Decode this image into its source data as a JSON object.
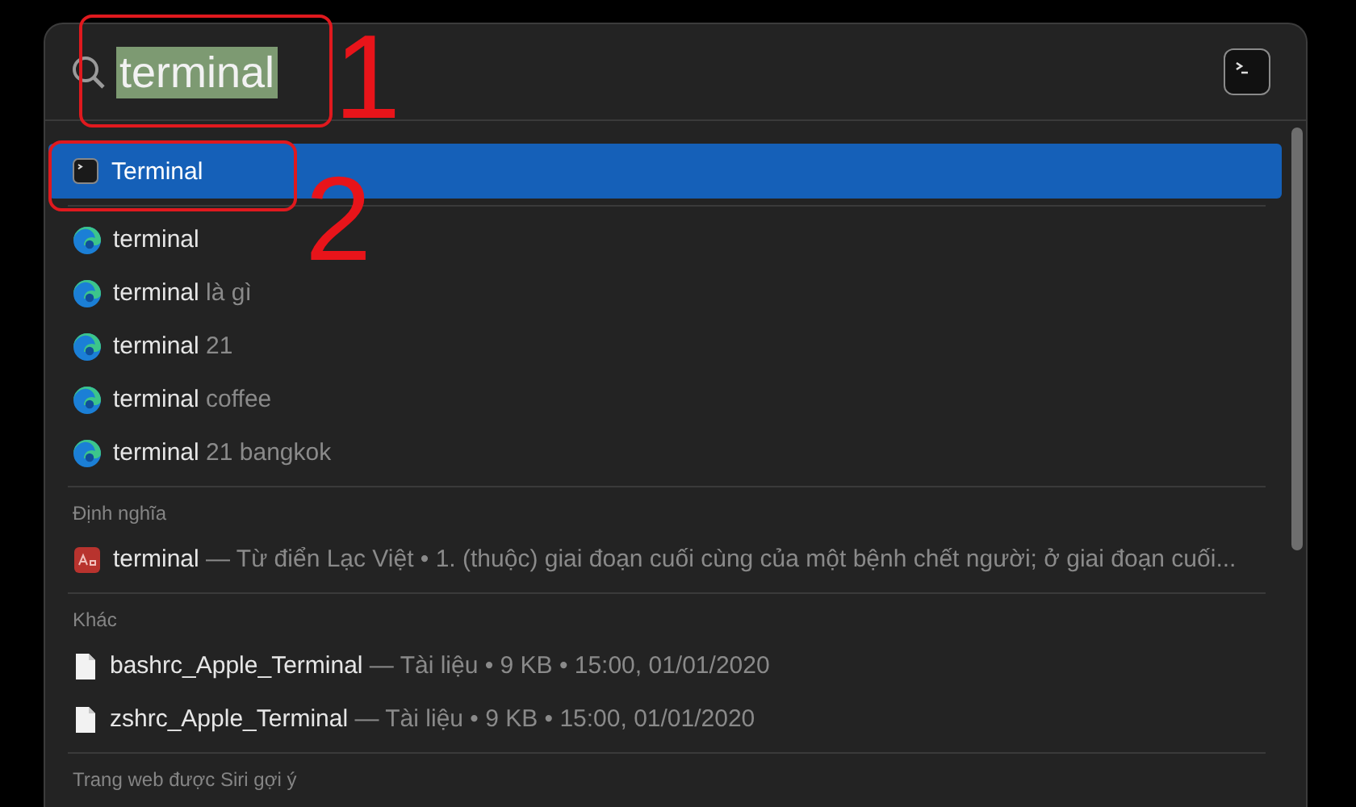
{
  "search": {
    "value": "terminal",
    "selected": true
  },
  "top_hit": {
    "label": "Terminal",
    "selected": true
  },
  "suggestions": [
    {
      "query": "terminal"
    },
    {
      "query": "terminal",
      "completion": "là gì"
    },
    {
      "query": "terminal",
      "completion": "21"
    },
    {
      "query": "terminal",
      "completion": "coffee"
    },
    {
      "query": "terminal",
      "completion": "21 bangkok"
    }
  ],
  "sections": [
    {
      "title": "Định nghĩa",
      "items": [
        {
          "kind": "dictionary",
          "name": "terminal",
          "detail": "— Từ điển Lạc Việt • 1. (thuộc) giai đoạn cuối cùng của một bệnh chết người; ở giai đoạn cuối..."
        }
      ]
    },
    {
      "title": "Khác",
      "items": [
        {
          "kind": "document",
          "name": "bashrc_Apple_Terminal",
          "detail": "— Tài liệu • 9 KB • 15:00, 01/01/2020"
        },
        {
          "kind": "document",
          "name": "zshrc_Apple_Terminal",
          "detail": "— Tài liệu • 9 KB • 15:00, 01/01/2020"
        }
      ]
    },
    {
      "title": "Trang web được Siri gợi ý"
    }
  ],
  "annotations": [
    {
      "label": "1"
    },
    {
      "label": "2"
    }
  ]
}
